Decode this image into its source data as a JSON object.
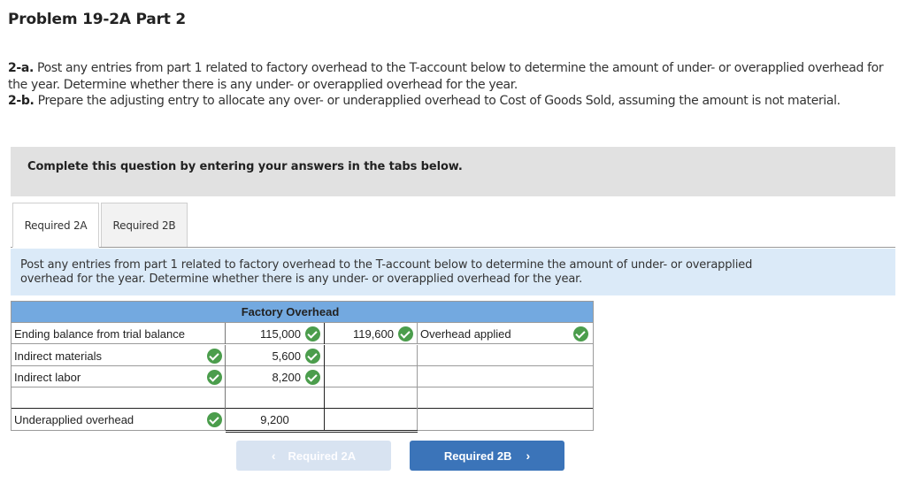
{
  "page": {
    "title": "Problem 19-2A Part 2"
  },
  "instructions": {
    "a_label": "2-a.",
    "a_text": " Post any entries from part 1 related to factory overhead to the T-account below to determine the amount of under- or overapplied overhead for the year. Determine whether there is any under- or overapplied overhead for the year.",
    "b_label": "2-b.",
    "b_text": " Prepare the adjusting entry to allocate any over- or underapplied overhead to Cost of Goods Sold, assuming the amount is not material."
  },
  "banner": {
    "text": "Complete this question by entering your answers in the tabs below."
  },
  "tabs": [
    {
      "label": "Required 2A",
      "active": true
    },
    {
      "label": "Required 2B",
      "active": false
    }
  ],
  "prompt": {
    "text": "Post any entries from part 1 related to factory overhead to the T-account below to determine the amount of under- or overapplied overhead for the year. Determine whether there is any under- or overapplied overhead for the year."
  },
  "taccount": {
    "title": "Factory Overhead",
    "rows": [
      {
        "debit_label": "Ending balance from trial balance",
        "debit_label_check": false,
        "debit_amount": "115,000",
        "debit_amount_check": true,
        "credit_amount": "119,600",
        "credit_amount_check": true,
        "credit_label": "Overhead applied",
        "credit_label_check": true
      },
      {
        "debit_label": "Indirect materials",
        "debit_label_check": true,
        "debit_amount": "5,600",
        "debit_amount_check": true,
        "credit_amount": "",
        "credit_label": ""
      },
      {
        "debit_label": "Indirect labor",
        "debit_label_check": true,
        "debit_amount": "8,200",
        "debit_amount_check": true,
        "credit_amount": "",
        "credit_label": ""
      },
      {
        "debit_label": "",
        "debit_amount": "",
        "credit_amount": "",
        "credit_label": ""
      }
    ],
    "total": {
      "debit_label": "Underapplied overhead",
      "debit_label_check": true,
      "debit_amount": "9,200",
      "credit_amount": "",
      "credit_label": ""
    }
  },
  "navigation": {
    "prev_label": "Required 2A",
    "prev_icon": "chevron-left-icon",
    "next_label": "Required 2B",
    "next_icon": "chevron-right-icon"
  },
  "colors": {
    "header_blue": "#73a9e0",
    "check_green": "#4b9d4c",
    "next_button": "#3b74b9",
    "prev_button_disabled": "#d8e3f1",
    "prompt_bg": "#dbeaf8"
  }
}
